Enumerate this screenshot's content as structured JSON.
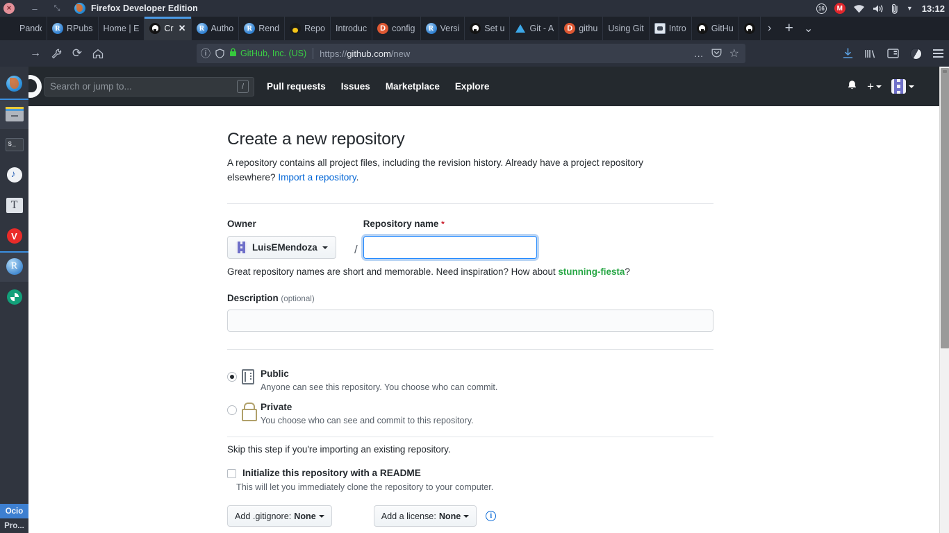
{
  "os": {
    "window_title": "Firefox Developer Edition",
    "close_glyph": "×",
    "minimize_glyph": "–",
    "maximize_glyph": "⤡",
    "tray": {
      "workspace_badge": "16",
      "mail_badge": "M",
      "wifi_icon": "wifi-icon",
      "volume_icon": "volume-icon",
      "clipboard_icon": "paperclip-icon",
      "dropdown_glyph": "▼",
      "clock": "13:12"
    }
  },
  "browser": {
    "tabs": [
      {
        "label": "Pandoc -",
        "icon": "plain-icon",
        "active": false
      },
      {
        "label": "RPubs",
        "icon": "rstudio-icon",
        "active": false
      },
      {
        "label": "Home | E",
        "icon": "plain-icon",
        "active": false
      },
      {
        "label": "Cr",
        "icon": "github-icon",
        "active": true
      },
      {
        "label": "Autho",
        "icon": "rstudio-icon",
        "active": false
      },
      {
        "label": "Rend",
        "icon": "rstudio-icon",
        "active": false
      },
      {
        "label": "Repo",
        "icon": "tux-icon",
        "active": false
      },
      {
        "label": "Introduc",
        "icon": "plain-icon",
        "active": false
      },
      {
        "label": "config",
        "icon": "duckduckgo-icon",
        "active": false
      },
      {
        "label": "Versi",
        "icon": "rstudio-icon",
        "active": false
      },
      {
        "label": "Set u",
        "icon": "github-icon",
        "active": false
      },
      {
        "label": "Git - A",
        "icon": "arch-icon",
        "active": false
      },
      {
        "label": "githu",
        "icon": "duckduckgo-icon",
        "active": false
      },
      {
        "label": "Using Git",
        "icon": "plain-icon",
        "active": false
      },
      {
        "label": "Intro",
        "icon": "gitlab-cat-icon",
        "active": false
      },
      {
        "label": "GitHu",
        "icon": "github-icon",
        "active": false
      },
      {
        "label": "",
        "icon": "github-icon",
        "active": false
      }
    ],
    "tab_close_glyph": "✕",
    "tab_scroll_right_glyph": "›",
    "new_tab_glyph": "+",
    "list_all_tabs_glyph": "⌄",
    "nav": {
      "back_glyph": "←",
      "forward_glyph": "→",
      "devtools_glyph": "⚒",
      "reload_glyph": "⟳",
      "home_glyph": "⌂"
    },
    "urlbar": {
      "info_glyph": "ⓘ",
      "shield_glyph": "⛉",
      "lock_glyph": "🔒",
      "owner": "GitHub, Inc. (US)",
      "url_prefix": "https://",
      "url_host": "github.com",
      "url_path": "/new",
      "page_actions_glyph": "…",
      "pocket_glyph": "▽",
      "bookmark_glyph": "☆"
    },
    "toolbar_right": {
      "downloads_glyph": "↓",
      "library_glyph": "‖‖",
      "sidebar_glyph": "◫",
      "account_icon": "account-icon",
      "menu_icon": "hamburger-menu-icon"
    }
  },
  "dock": {
    "items": [
      {
        "name": "firefox",
        "active": false
      },
      {
        "name": "files",
        "active": true
      },
      {
        "name": "terminal",
        "active": false
      },
      {
        "name": "music",
        "active": false
      },
      {
        "name": "texstudio",
        "label": "T",
        "active": false
      },
      {
        "name": "vivaldi",
        "label": "V",
        "active": false
      },
      {
        "name": "rstudio",
        "label": "R",
        "active": true
      },
      {
        "name": "screenshot",
        "active": false
      }
    ],
    "workspaces": [
      {
        "label": "Ocio",
        "selected": true
      },
      {
        "label": "Pro...",
        "selected": false
      }
    ]
  },
  "github": {
    "header": {
      "logo": "github-mark-icon",
      "search_placeholder": "Search or jump to...",
      "search_value": "",
      "slash_badge": "/",
      "nav": [
        "Pull requests",
        "Issues",
        "Marketplace",
        "Explore"
      ],
      "bell_glyph": "🔔",
      "plus_glyph": "+",
      "avatar": "user-avatar"
    },
    "page": {
      "title": "Create a new repository",
      "lede_part1": "A repository contains all project files, including the revision history. Already have a project repository elsewhere? ",
      "lede_link": "Import a repository",
      "lede_part2": ".",
      "owner_label": "Owner",
      "owner_value": "LuisEMendoza",
      "separator": "/",
      "repo_name_label": "Repository name",
      "required_mark": "*",
      "repo_name_value": "",
      "hint_part1": "Great repository names are short and memorable. Need inspiration? How about ",
      "hint_suggestion": "stunning-fiesta",
      "hint_part2": "?",
      "description_label": "Description",
      "description_optional": "(optional)",
      "description_value": "",
      "visibility": [
        {
          "id": "public",
          "title": "Public",
          "subtitle": "Anyone can see this repository. You choose who can commit.",
          "selected": true,
          "icon": "repo-book-icon"
        },
        {
          "id": "private",
          "title": "Private",
          "subtitle": "You choose who can see and commit to this repository.",
          "selected": false,
          "icon": "lock-icon"
        }
      ],
      "skip_text": "Skip this step if you're importing an existing repository.",
      "readme_checked": false,
      "readme_title": "Initialize this repository with a README",
      "readme_subtitle": "This will let you immediately clone the repository to your computer.",
      "gitignore_prefix": "Add .gitignore: ",
      "gitignore_value": "None",
      "license_prefix": "Add a license: ",
      "license_value": "None",
      "info_glyph": "i"
    }
  },
  "colors": {
    "github_header_bg": "#24292e",
    "focus_blue": "#2188ff",
    "link_blue": "#0366d6",
    "suggestion_green": "#28a745",
    "required_red": "#cb2431",
    "desktop_bg": "#2b303b"
  }
}
